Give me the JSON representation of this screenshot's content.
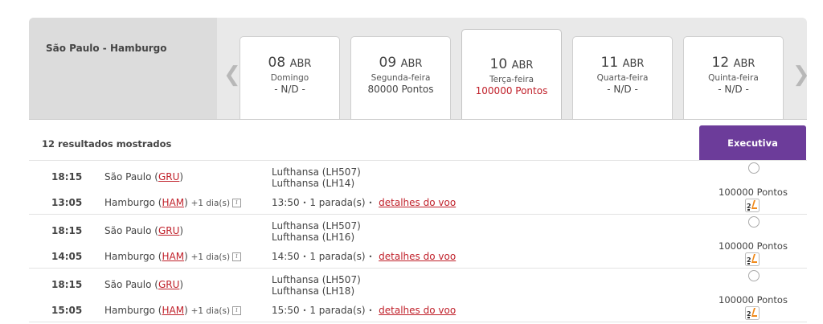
{
  "header": {
    "route": "São Paulo - Hamburgo",
    "prev_arrow": "❮",
    "next_arrow": "❯"
  },
  "dates": [
    {
      "day": "08",
      "month": "ABR",
      "weekday": "Domingo",
      "points": "- N/D -"
    },
    {
      "day": "09",
      "month": "ABR",
      "weekday": "Segunda-feira",
      "points": "80000 Pontos"
    },
    {
      "day": "10",
      "month": "ABR",
      "weekday": "Terça-feira",
      "points": "100000 Pontos",
      "selected": true
    },
    {
      "day": "11",
      "month": "ABR",
      "weekday": "Quarta-feira",
      "points": "- N/D -"
    },
    {
      "day": "12",
      "month": "ABR",
      "weekday": "Quinta-feira",
      "points": "- N/D -"
    }
  ],
  "results": {
    "count_label": "12 resultados mostrados",
    "cabin": "Executiva"
  },
  "flights": [
    {
      "dep_time": "18:15",
      "dep_city": "São Paulo (",
      "dep_code": "GRU",
      "dep_close": ")",
      "arr_time": "13:05",
      "arr_city": "Hamburgo (",
      "arr_code": "HAM",
      "arr_close": ")",
      "plus_day": "+1 dia(s)",
      "flight1": "Lufthansa (LH507)",
      "flight2": "Lufthansa (LH14)",
      "duration": "13:50",
      "stops": "1 parada(s)",
      "details": "detalhes do voo",
      "points": "100000 Pontos"
    },
    {
      "dep_time": "18:15",
      "dep_city": "São Paulo (",
      "dep_code": "GRU",
      "dep_close": ")",
      "arr_time": "14:05",
      "arr_city": "Hamburgo (",
      "arr_code": "HAM",
      "arr_close": ")",
      "plus_day": "+1 dia(s)",
      "flight1": "Lufthansa (LH507)",
      "flight2": "Lufthansa (LH16)",
      "duration": "14:50",
      "stops": "1 parada(s)",
      "details": "detalhes do voo",
      "points": "100000 Pontos"
    },
    {
      "dep_time": "18:15",
      "dep_city": "São Paulo (",
      "dep_code": "GRU",
      "dep_close": ")",
      "arr_time": "15:05",
      "arr_city": "Hamburgo (",
      "arr_code": "HAM",
      "arr_close": ")",
      "plus_day": "+1 dia(s)",
      "flight1": "Lufthansa (LH507)",
      "flight2": "Lufthansa (LH18)",
      "duration": "15:50",
      "stops": "1 parada(s)",
      "details": "detalhes do voo",
      "points": "100000 Pontos"
    }
  ],
  "icons": {
    "info": "i",
    "dot": "•",
    "seat": "seat-recline-icon"
  },
  "colors": {
    "accent_red": "#c0202a",
    "cabin_purple": "#6c3c9a",
    "seat_orange": "#f08a1c"
  }
}
